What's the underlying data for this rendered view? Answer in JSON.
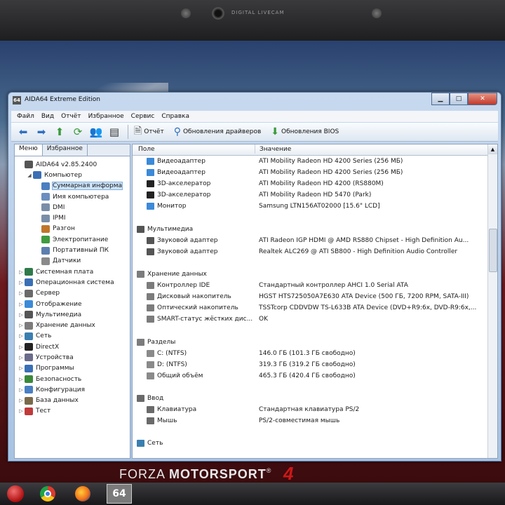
{
  "bezel": {
    "camera_label": "DIGITAL LIVECAM"
  },
  "wallpaper": {
    "brand_left": "FORZA",
    "brand_right": "MOTORSPORT",
    "brand_mark": "®",
    "logo": "4"
  },
  "window": {
    "title": "AIDA64 Extreme Edition",
    "app_icon_text": "64"
  },
  "menu": [
    "Файл",
    "Вид",
    "Отчёт",
    "Избранное",
    "Сервис",
    "Справка"
  ],
  "toolbar": {
    "report_label": "Отчёт",
    "driver_updates_label": "Обновления драйверов",
    "bios_updates_label": "Обновления BIOS"
  },
  "left_tabs": [
    "Меню",
    "Избранное"
  ],
  "tree": [
    {
      "label": "AIDA64 v2.85.2400",
      "level": 0,
      "arrow": "",
      "icon": "#555555"
    },
    {
      "label": "Компьютер",
      "level": 1,
      "arrow": "◢",
      "icon": "#3a6fb5"
    },
    {
      "label": "Суммарная информа",
      "level": 2,
      "arrow": "",
      "icon": "#4a7fc1",
      "selected": true
    },
    {
      "label": "Имя компьютера",
      "level": 2,
      "arrow": "",
      "icon": "#6b8fbf"
    },
    {
      "label": "DMI",
      "level": 2,
      "arrow": "",
      "icon": "#7a8ea8"
    },
    {
      "label": "IPMI",
      "level": 2,
      "arrow": "",
      "icon": "#7a8ea8"
    },
    {
      "label": "Разгон",
      "level": 2,
      "arrow": "",
      "icon": "#c0762a"
    },
    {
      "label": "Электропитание",
      "level": 2,
      "arrow": "",
      "icon": "#3f9b3f"
    },
    {
      "label": "Портативный ПК",
      "level": 2,
      "arrow": "",
      "icon": "#5d7fae"
    },
    {
      "label": "Датчики",
      "level": 2,
      "arrow": "",
      "icon": "#8a8a8a"
    },
    {
      "label": "Системная плата",
      "level": 0,
      "arrow": "▷",
      "icon": "#2f7a4a"
    },
    {
      "label": "Операционная система",
      "level": 0,
      "arrow": "▷",
      "icon": "#3a6fb5"
    },
    {
      "label": "Сервер",
      "level": 0,
      "arrow": "▷",
      "icon": "#6a6a6a"
    },
    {
      "label": "Отображение",
      "level": 0,
      "arrow": "▷",
      "icon": "#3c8ad8"
    },
    {
      "label": "Мультимедиа",
      "level": 0,
      "arrow": "▷",
      "icon": "#555555"
    },
    {
      "label": "Хранение данных",
      "level": 0,
      "arrow": "▷",
      "icon": "#7c7c7c"
    },
    {
      "label": "Сеть",
      "level": 0,
      "arrow": "▷",
      "icon": "#3a7fb0"
    },
    {
      "label": "DirectX",
      "level": 0,
      "arrow": "▷",
      "icon": "#222222"
    },
    {
      "label": "Устройства",
      "level": 0,
      "arrow": "▷",
      "icon": "#6b6b8a"
    },
    {
      "label": "Программы",
      "level": 0,
      "arrow": "▷",
      "icon": "#3a6fb5"
    },
    {
      "label": "Безопасность",
      "level": 0,
      "arrow": "▷",
      "icon": "#3a8a3a"
    },
    {
      "label": "Конфигурация",
      "level": 0,
      "arrow": "▷",
      "icon": "#4a7fc1"
    },
    {
      "label": "База данных",
      "level": 0,
      "arrow": "▷",
      "icon": "#7a6a4a"
    },
    {
      "label": "Тест",
      "level": 0,
      "arrow": "▷",
      "icon": "#c03a3a"
    }
  ],
  "columns": {
    "field": "Поле",
    "value": "Значение"
  },
  "rows": [
    {
      "type": "item",
      "field": "Видеоадаптер",
      "value": "ATI Mobility Radeon HD 4200 Series  (256 МБ)",
      "icon": "#3c8ad8"
    },
    {
      "type": "item",
      "field": "Видеоадаптер",
      "value": "ATI Mobility Radeon HD 4200 Series  (256 МБ)",
      "icon": "#3c8ad8"
    },
    {
      "type": "item",
      "field": "3D-акселератор",
      "value": "ATI Mobility Radeon HD 4200 (RS880M)",
      "icon": "#222222"
    },
    {
      "type": "item",
      "field": "3D-акселератор",
      "value": "ATI Mobility Radeon HD 5470 (Park)",
      "icon": "#222222"
    },
    {
      "type": "item",
      "field": "Монитор",
      "value": "Samsung LTN156AT02000  [15.6\" LCD]",
      "icon": "#3c8ad8"
    },
    {
      "type": "gap"
    },
    {
      "type": "section",
      "field": "Мультимедиа",
      "icon": "#555555"
    },
    {
      "type": "item",
      "field": "Звуковой адаптер",
      "value": "ATI Radeon IGP HDMI @ AMD RS880 Chipset - High Definition Au...",
      "icon": "#555555"
    },
    {
      "type": "item",
      "field": "Звуковой адаптер",
      "value": "Realtek ALC269 @ ATI SB800 - High Definition Audio Controller",
      "icon": "#555555"
    },
    {
      "type": "gap"
    },
    {
      "type": "section",
      "field": "Хранение данных",
      "icon": "#7c7c7c"
    },
    {
      "type": "item",
      "field": "Контроллер IDE",
      "value": "Стандартный контроллер AHCI 1.0 Serial ATA",
      "icon": "#7c7c7c"
    },
    {
      "type": "item",
      "field": "Дисковый накопитель",
      "value": "HGST HTS725050A7E630 ATA Device  (500 ГБ, 7200 RPM, SATA-III)",
      "icon": "#7c7c7c"
    },
    {
      "type": "item",
      "field": "Оптический накопитель",
      "value": "TSSTcorp CDDVDW TS-L633B ATA Device  (DVD+R9:6x, DVD-R9:6x,...",
      "icon": "#7c7c7c"
    },
    {
      "type": "item",
      "field": "SMART-статус жёстких дис...",
      "value": "OK",
      "icon": "#7c7c7c"
    },
    {
      "type": "gap"
    },
    {
      "type": "section",
      "field": "Разделы",
      "icon": "#7c7c7c"
    },
    {
      "type": "item",
      "field": "C: (NTFS)",
      "value": "146.0 ГБ (101.3 ГБ свободно)",
      "icon": "#8a8a8a"
    },
    {
      "type": "item",
      "field": "D: (NTFS)",
      "value": "319.3 ГБ (319.2 ГБ свободно)",
      "icon": "#8a8a8a"
    },
    {
      "type": "item",
      "field": "Общий объём",
      "value": "465.3 ГБ (420.4 ГБ свободно)",
      "icon": "#8a8a8a"
    },
    {
      "type": "gap"
    },
    {
      "type": "section",
      "field": "Ввод",
      "icon": "#6a6a6a"
    },
    {
      "type": "item",
      "field": "Клавиатура",
      "value": "Стандартная клавиатура PS/2",
      "icon": "#6a6a6a"
    },
    {
      "type": "item",
      "field": "Мышь",
      "value": "PS/2-совместимая мышь",
      "icon": "#6a6a6a"
    },
    {
      "type": "gap"
    },
    {
      "type": "section",
      "field": "Сеть",
      "icon": "#3a7fb0"
    }
  ]
}
